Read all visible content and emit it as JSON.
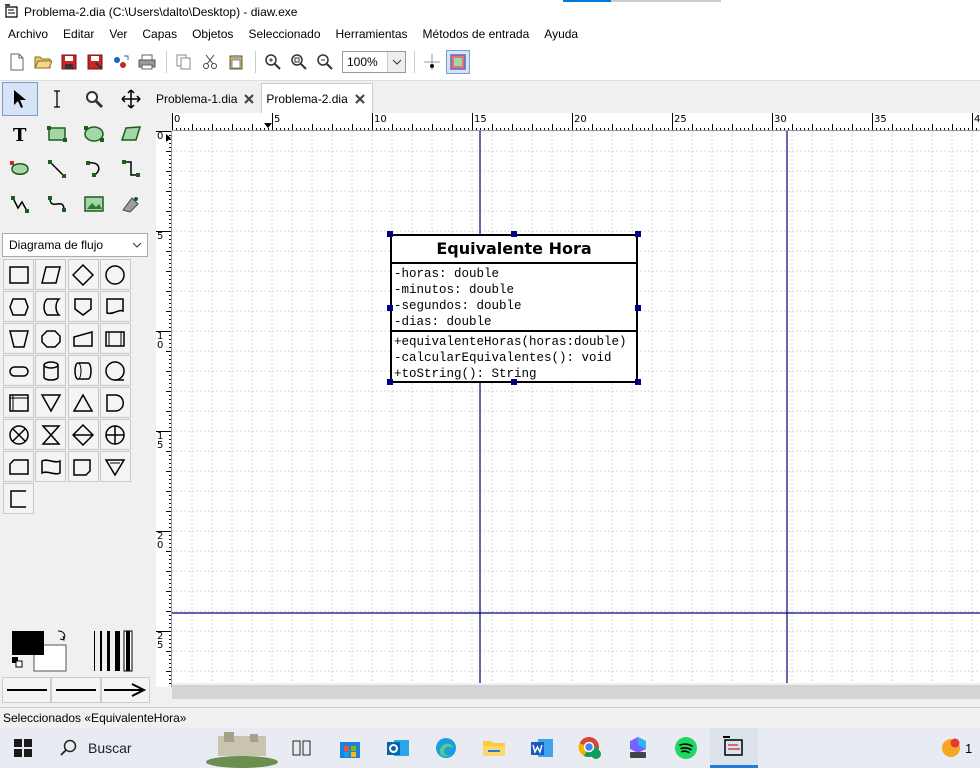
{
  "window": {
    "title": "Problema-2.dia (C:\\Users\\dalto\\Desktop) - diaw.exe",
    "icon": "dia-app-icon"
  },
  "menu": [
    {
      "label": "Archivo"
    },
    {
      "label": "Editar"
    },
    {
      "label": "Ver"
    },
    {
      "label": "Capas"
    },
    {
      "label": "Objetos"
    },
    {
      "label": "Seleccionado"
    },
    {
      "label": "Herramientas"
    },
    {
      "label": "Métodos de entrada"
    },
    {
      "label": "Ayuda"
    }
  ],
  "toolbar": {
    "zoom": "100%"
  },
  "toolbox": {
    "sheet": "Diagrama de flujo"
  },
  "tabs": [
    {
      "label": "Problema-1.dia",
      "active": false
    },
    {
      "label": "Problema-2.dia",
      "active": true
    }
  ],
  "rulers": {
    "horizontal": [
      "0",
      "5",
      "10",
      "15",
      "20",
      "25",
      "30",
      "35",
      "4"
    ],
    "vertical": [
      "0",
      "5",
      "1\n0",
      "1\n5",
      "2\n0",
      "2\n5"
    ]
  },
  "uml_class": {
    "name": "Equivalente Hora",
    "attributes": [
      "-horas: double",
      "-minutos: double",
      "-segundos: double",
      "-dias: double"
    ],
    "operations": [
      "+equivalenteHoras(horas:double)",
      "-calcularEquivalentes(): void",
      "+toString(): String"
    ]
  },
  "status": "Seleccionados «EquivalenteHora»",
  "taskbar": {
    "search_label": "Buscar",
    "notification_count": "1"
  },
  "colors": {
    "guide_line": "#000080",
    "handle": "#000080",
    "grid": "#d7d7d7"
  }
}
